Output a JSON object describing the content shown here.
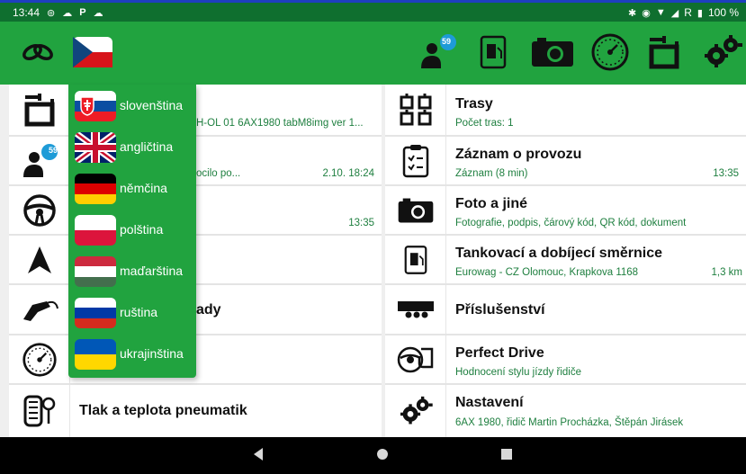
{
  "status_bar": {
    "time": "13:44",
    "left_icons": [
      "voicemail-icon",
      "cloud-icon",
      "parking-icon",
      "cloud-icon"
    ],
    "right_icons": [
      "bluetooth-icon",
      "location-icon",
      "wifi-icon",
      "signal-icon"
    ],
    "roaming": "R",
    "battery": "100 %"
  },
  "toolbar": {
    "icons": [
      "logo-icon",
      "flag-cz-icon",
      "messages-icon",
      "fuel-document-icon",
      "camera-icon",
      "tachograph-icon",
      "route-icon",
      "settings-icon"
    ],
    "messages_badge": "59"
  },
  "language_menu": {
    "items": [
      {
        "label": "slovenština",
        "flag": "sk"
      },
      {
        "label": "angličtina",
        "flag": "gb"
      },
      {
        "label": "němčina",
        "flag": "de"
      },
      {
        "label": "polština",
        "flag": "pl"
      },
      {
        "label": "maďarština",
        "flag": "hu"
      },
      {
        "label": "ruština",
        "flag": "ru"
      },
      {
        "label": "ukrajinština",
        "flag": "ua"
      }
    ]
  },
  "left_list": {
    "row1": {
      "icon": "route-icon",
      "sub_fragment": "H-OL  01 6AX1980 tabM8img ver 1..."
    },
    "row2": {
      "icon": "messages-icon",
      "badge": "59",
      "sub_fragment": "ocilo po...",
      "meta": "2.10. 18:24"
    },
    "row3": {
      "icon": "steering-wheel-icon",
      "meta": "13:35"
    },
    "row4": {
      "icon": "navigation-arrow-icon"
    },
    "row5": {
      "icon": "fuel-nozzle-icon",
      "title_fragment": "ady"
    },
    "row6": {
      "icon": "tachograph-icon"
    },
    "row7": {
      "icon": "tire-pressure-icon",
      "title": "Tlak a teplota pneumatik"
    }
  },
  "right_list": {
    "row1": {
      "icon": "routes-icon",
      "title": "Trasy",
      "sub": "Počet tras: 1"
    },
    "row2": {
      "icon": "clipboard-icon",
      "title": "Záznam o provozu",
      "sub": "Záznam (8 min)",
      "meta": "13:35"
    },
    "row3": {
      "icon": "camera-icon",
      "title": "Foto a jiné",
      "sub": "Fotografie, podpis, čárový kód, QR kód, dokument"
    },
    "row4": {
      "icon": "fuel-document-icon",
      "title": "Tankovací a dobíjecí směrnice",
      "sub": "Eurowag - CZ Olomouc, Krapkova 1168",
      "meta": "1,3 km"
    },
    "row5": {
      "icon": "trailer-icon",
      "title": "Příslušenství"
    },
    "row6": {
      "icon": "perfect-drive-icon",
      "title": "Perfect Drive",
      "sub": "Hodnocení stylu jízdy řidiče"
    },
    "row7": {
      "icon": "settings-icon",
      "title": "Nastavení",
      "sub": "6AX 1980, řidič Martin Procházka, Štěpán Jirásek"
    }
  },
  "nav_bar": {
    "buttons": [
      "back-icon",
      "home-icon",
      "recents-icon"
    ]
  },
  "colors": {
    "primary_green": "#21a33f",
    "status_green": "#0f6f2f",
    "link_green": "#1e7f3f",
    "badge_blue": "#1e9bd7"
  }
}
